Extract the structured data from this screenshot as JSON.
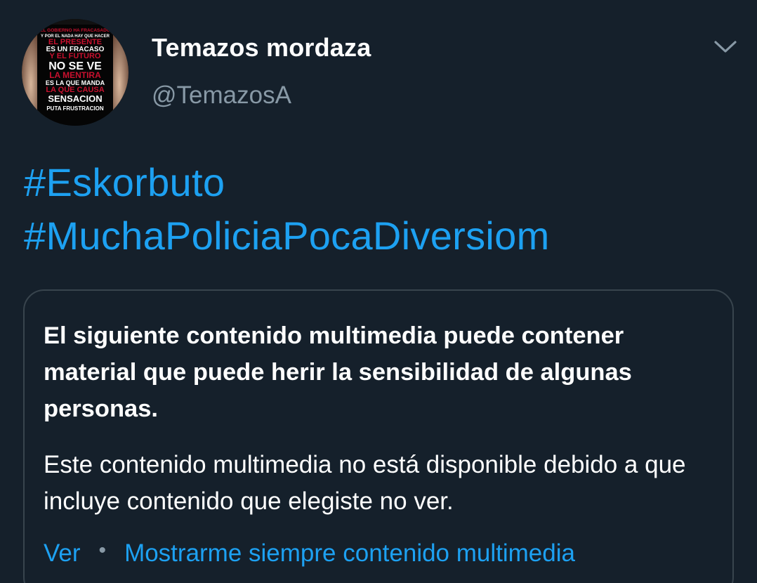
{
  "tweet": {
    "author": {
      "display_name": "Temazos mordaza",
      "handle": "@TemazosA",
      "avatar_lines": [
        "EL GOBIERNO HA FRACASADO",
        "Y POR EL NADA HAY QUE HACER",
        "EL PRESENTE",
        "ES UN FRACASO",
        "Y EL FUTURO",
        "NO SE VE",
        "LA MENTIRA",
        "ES LA QUE MANDA",
        "LA QUE CAUSA",
        "SENSACION",
        "PUTA FRUSTRACION"
      ]
    },
    "hashtags": [
      "#Eskorbuto",
      "#MuchaPoliciaPocaDiversiom"
    ],
    "media_warning": {
      "title": "El siguiente contenido multimedia puede contener material que puede herir la sensibilidad de algunas personas.",
      "body": "Este contenido multimedia no está disponible debido a que incluye contenido que elegiste no ver.",
      "view_label": "Ver",
      "separator": "•",
      "always_show_label": "Mostrarme siempre contenido multimedia"
    },
    "icons": {
      "menu": "chevron-down-icon"
    },
    "colors": {
      "background": "#15202b",
      "link": "#1da1f2",
      "secondary_text": "#8899a6",
      "border": "#38444d",
      "avatar_red": "#c8102e"
    }
  }
}
